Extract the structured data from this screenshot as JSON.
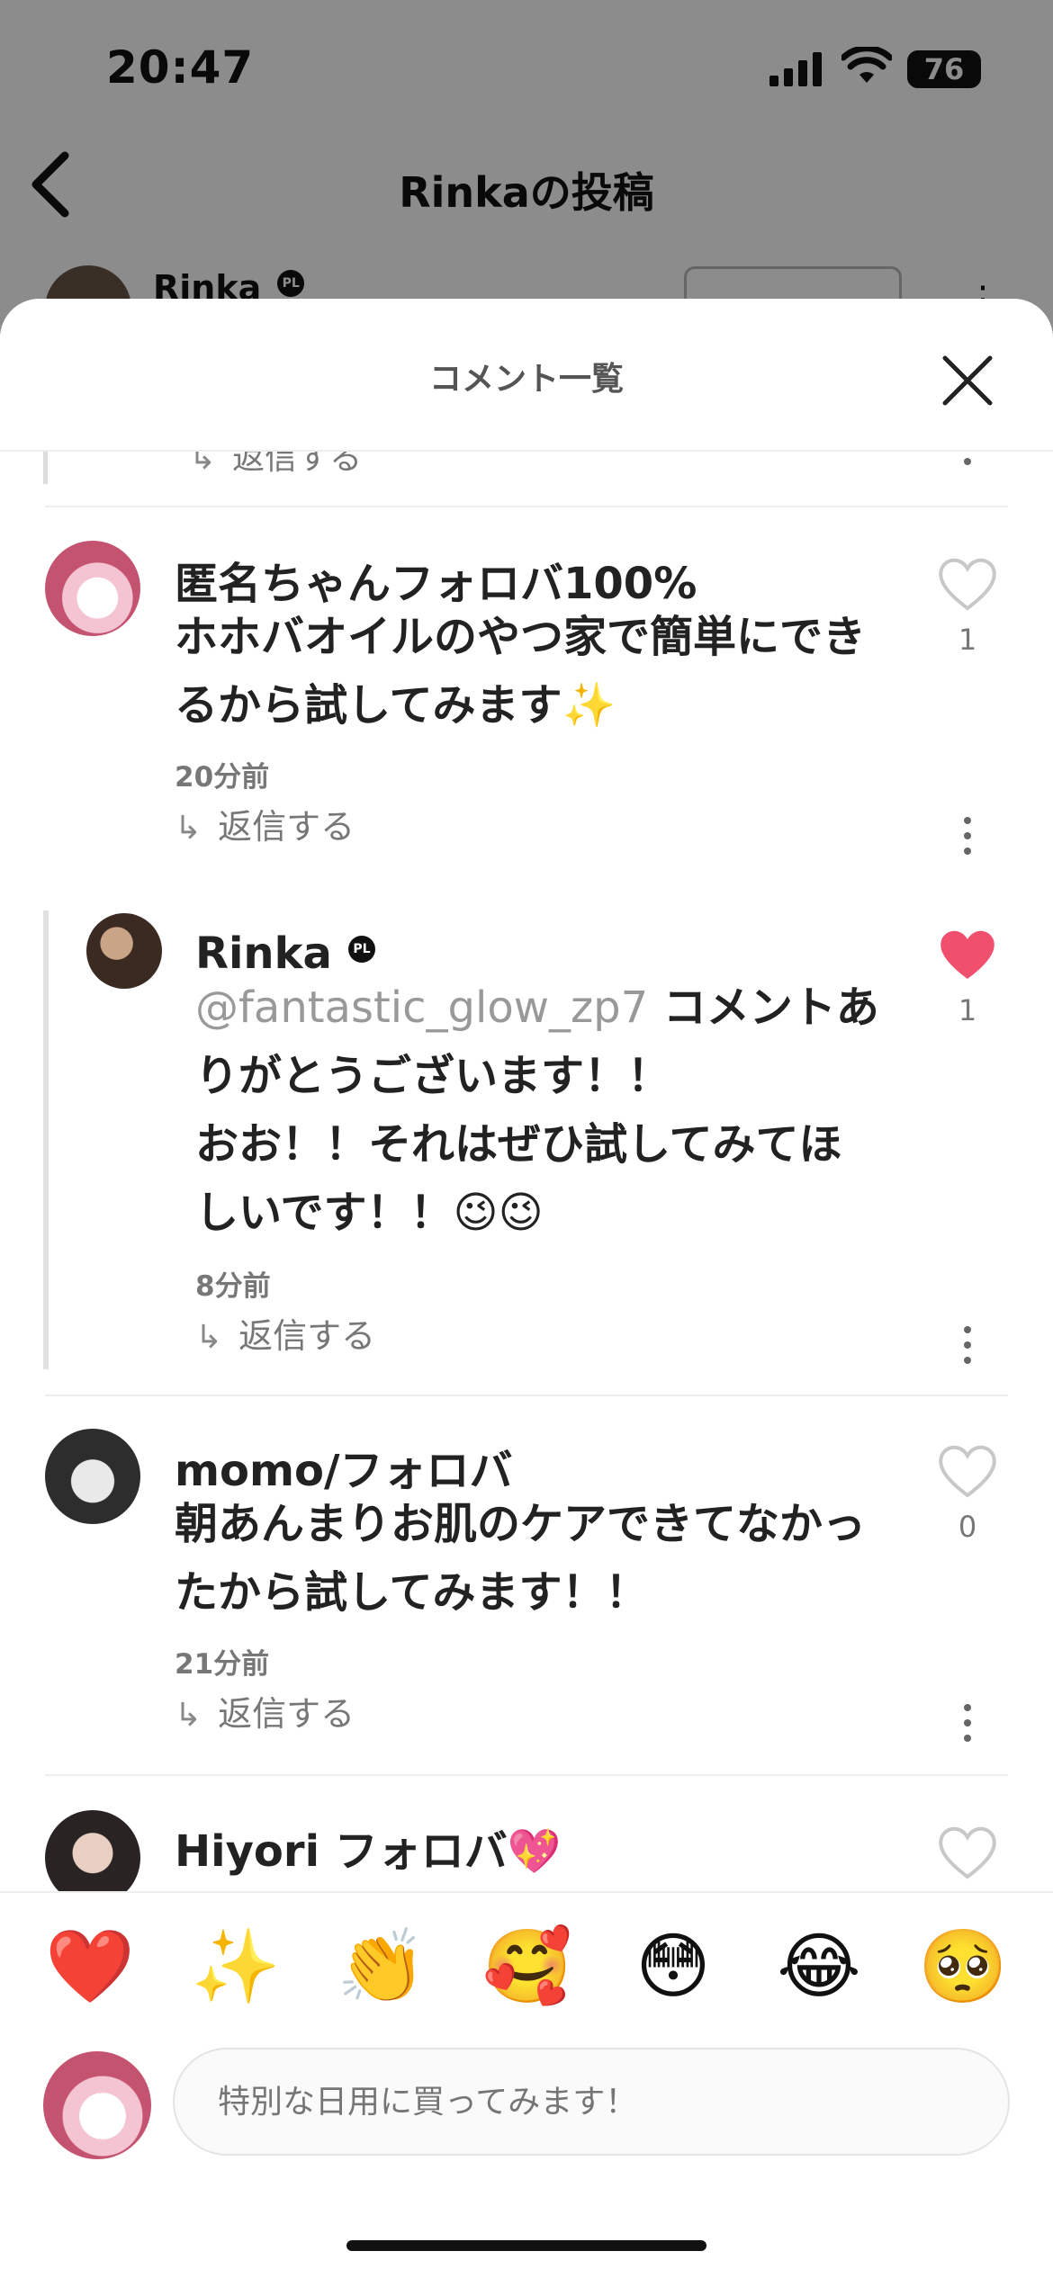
{
  "status_bar": {
    "time": "20:47",
    "battery": "76"
  },
  "nav": {
    "title": "Rinkaの投稿"
  },
  "post": {
    "author": "Rinka",
    "badge": "PL"
  },
  "sheet": {
    "title": "コメント一覧"
  },
  "partial": {
    "reply_label": "返信する"
  },
  "comments": [
    {
      "name": "匿名ちゃんフォロバ100%",
      "body_line1": "ホホバオイルのやつ家で簡単にでき",
      "body_line2": "るから試してみます✨",
      "time": "20分前",
      "reply_label": "返信する",
      "likes": "1",
      "liked": false
    },
    {
      "name": "Rinka",
      "badge": "PL",
      "mention": "@fantastic_glow_zp7",
      "body_line1": " コメントあ",
      "body_line2": "りがとうございます！！",
      "body_line3": "おお！！それはぜひ試してみてほ",
      "body_line4": "しいです！！😉😉",
      "time": "8分前",
      "reply_label": "返信する",
      "likes": "1",
      "liked": true
    },
    {
      "name": "momo/フォロバ",
      "body_line1": "朝あんまりお肌のケアできてなかっ",
      "body_line2": "たから試してみます！！",
      "time": "21分前",
      "reply_label": "返信する",
      "likes": "0",
      "liked": false
    },
    {
      "name": "Hiyori フォロバ💖",
      "liked": false
    }
  ],
  "emoji_bar": [
    "❤️",
    "✨",
    "👏",
    "🥰",
    "😳",
    "😂",
    "🥺"
  ],
  "input": {
    "placeholder": "特別な日用に買ってみます！"
  },
  "colors": {
    "like_red": "#f0506e",
    "heart_outline": "#c8c8c8"
  }
}
